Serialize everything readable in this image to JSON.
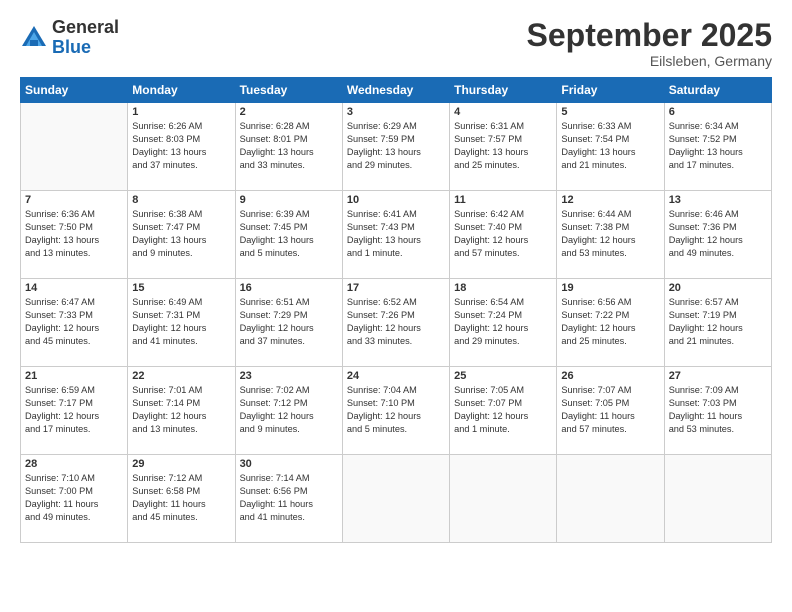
{
  "header": {
    "logo_general": "General",
    "logo_blue": "Blue",
    "month_title": "September 2025",
    "location": "Eilsleben, Germany"
  },
  "days_of_week": [
    "Sunday",
    "Monday",
    "Tuesday",
    "Wednesday",
    "Thursday",
    "Friday",
    "Saturday"
  ],
  "weeks": [
    [
      {
        "day": "",
        "info": ""
      },
      {
        "day": "1",
        "info": "Sunrise: 6:26 AM\nSunset: 8:03 PM\nDaylight: 13 hours\nand 37 minutes."
      },
      {
        "day": "2",
        "info": "Sunrise: 6:28 AM\nSunset: 8:01 PM\nDaylight: 13 hours\nand 33 minutes."
      },
      {
        "day": "3",
        "info": "Sunrise: 6:29 AM\nSunset: 7:59 PM\nDaylight: 13 hours\nand 29 minutes."
      },
      {
        "day": "4",
        "info": "Sunrise: 6:31 AM\nSunset: 7:57 PM\nDaylight: 13 hours\nand 25 minutes."
      },
      {
        "day": "5",
        "info": "Sunrise: 6:33 AM\nSunset: 7:54 PM\nDaylight: 13 hours\nand 21 minutes."
      },
      {
        "day": "6",
        "info": "Sunrise: 6:34 AM\nSunset: 7:52 PM\nDaylight: 13 hours\nand 17 minutes."
      }
    ],
    [
      {
        "day": "7",
        "info": "Sunrise: 6:36 AM\nSunset: 7:50 PM\nDaylight: 13 hours\nand 13 minutes."
      },
      {
        "day": "8",
        "info": "Sunrise: 6:38 AM\nSunset: 7:47 PM\nDaylight: 13 hours\nand 9 minutes."
      },
      {
        "day": "9",
        "info": "Sunrise: 6:39 AM\nSunset: 7:45 PM\nDaylight: 13 hours\nand 5 minutes."
      },
      {
        "day": "10",
        "info": "Sunrise: 6:41 AM\nSunset: 7:43 PM\nDaylight: 13 hours\nand 1 minute."
      },
      {
        "day": "11",
        "info": "Sunrise: 6:42 AM\nSunset: 7:40 PM\nDaylight: 12 hours\nand 57 minutes."
      },
      {
        "day": "12",
        "info": "Sunrise: 6:44 AM\nSunset: 7:38 PM\nDaylight: 12 hours\nand 53 minutes."
      },
      {
        "day": "13",
        "info": "Sunrise: 6:46 AM\nSunset: 7:36 PM\nDaylight: 12 hours\nand 49 minutes."
      }
    ],
    [
      {
        "day": "14",
        "info": "Sunrise: 6:47 AM\nSunset: 7:33 PM\nDaylight: 12 hours\nand 45 minutes."
      },
      {
        "day": "15",
        "info": "Sunrise: 6:49 AM\nSunset: 7:31 PM\nDaylight: 12 hours\nand 41 minutes."
      },
      {
        "day": "16",
        "info": "Sunrise: 6:51 AM\nSunset: 7:29 PM\nDaylight: 12 hours\nand 37 minutes."
      },
      {
        "day": "17",
        "info": "Sunrise: 6:52 AM\nSunset: 7:26 PM\nDaylight: 12 hours\nand 33 minutes."
      },
      {
        "day": "18",
        "info": "Sunrise: 6:54 AM\nSunset: 7:24 PM\nDaylight: 12 hours\nand 29 minutes."
      },
      {
        "day": "19",
        "info": "Sunrise: 6:56 AM\nSunset: 7:22 PM\nDaylight: 12 hours\nand 25 minutes."
      },
      {
        "day": "20",
        "info": "Sunrise: 6:57 AM\nSunset: 7:19 PM\nDaylight: 12 hours\nand 21 minutes."
      }
    ],
    [
      {
        "day": "21",
        "info": "Sunrise: 6:59 AM\nSunset: 7:17 PM\nDaylight: 12 hours\nand 17 minutes."
      },
      {
        "day": "22",
        "info": "Sunrise: 7:01 AM\nSunset: 7:14 PM\nDaylight: 12 hours\nand 13 minutes."
      },
      {
        "day": "23",
        "info": "Sunrise: 7:02 AM\nSunset: 7:12 PM\nDaylight: 12 hours\nand 9 minutes."
      },
      {
        "day": "24",
        "info": "Sunrise: 7:04 AM\nSunset: 7:10 PM\nDaylight: 12 hours\nand 5 minutes."
      },
      {
        "day": "25",
        "info": "Sunrise: 7:05 AM\nSunset: 7:07 PM\nDaylight: 12 hours\nand 1 minute."
      },
      {
        "day": "26",
        "info": "Sunrise: 7:07 AM\nSunset: 7:05 PM\nDaylight: 11 hours\nand 57 minutes."
      },
      {
        "day": "27",
        "info": "Sunrise: 7:09 AM\nSunset: 7:03 PM\nDaylight: 11 hours\nand 53 minutes."
      }
    ],
    [
      {
        "day": "28",
        "info": "Sunrise: 7:10 AM\nSunset: 7:00 PM\nDaylight: 11 hours\nand 49 minutes."
      },
      {
        "day": "29",
        "info": "Sunrise: 7:12 AM\nSunset: 6:58 PM\nDaylight: 11 hours\nand 45 minutes."
      },
      {
        "day": "30",
        "info": "Sunrise: 7:14 AM\nSunset: 6:56 PM\nDaylight: 11 hours\nand 41 minutes."
      },
      {
        "day": "",
        "info": ""
      },
      {
        "day": "",
        "info": ""
      },
      {
        "day": "",
        "info": ""
      },
      {
        "day": "",
        "info": ""
      }
    ]
  ]
}
